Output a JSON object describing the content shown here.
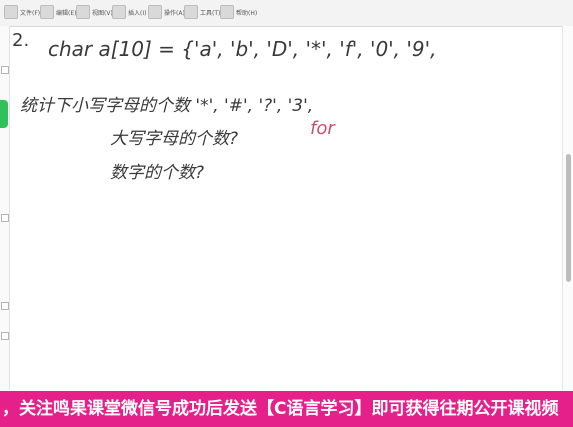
{
  "toolbar": {
    "items": [
      {
        "icon": "file-icon",
        "label": "文件(F)"
      },
      {
        "icon": "edit-icon",
        "label": "编辑(E)"
      },
      {
        "icon": "view-icon",
        "label": "视图(V)"
      },
      {
        "icon": "insert-icon",
        "label": "插入(I)"
      },
      {
        "icon": "actions-icon",
        "label": "操作(A)"
      },
      {
        "icon": "tools-icon",
        "label": "工具(T)"
      },
      {
        "icon": "help-icon",
        "label": "帮助(H)"
      }
    ]
  },
  "ink": {
    "line1": "char  a[10] = {'a', 'b', 'D', '*', 'f', '0', '9',",
    "line2": "统计下小写字母的个数   '*', '#', '?', '3',",
    "line3": "大写字母的个数?",
    "line4": "数字的个数?",
    "note": "for"
  },
  "banner": {
    "text": "，关注鸣果课堂微信号成功后发送【C语言学习】即可获得往期公开课视频"
  },
  "colors": {
    "ink": "#3a3a3a",
    "accent_ink": "#c8506b",
    "banner_bg": "#e6208a",
    "rail_tab": "#2fc25b"
  }
}
